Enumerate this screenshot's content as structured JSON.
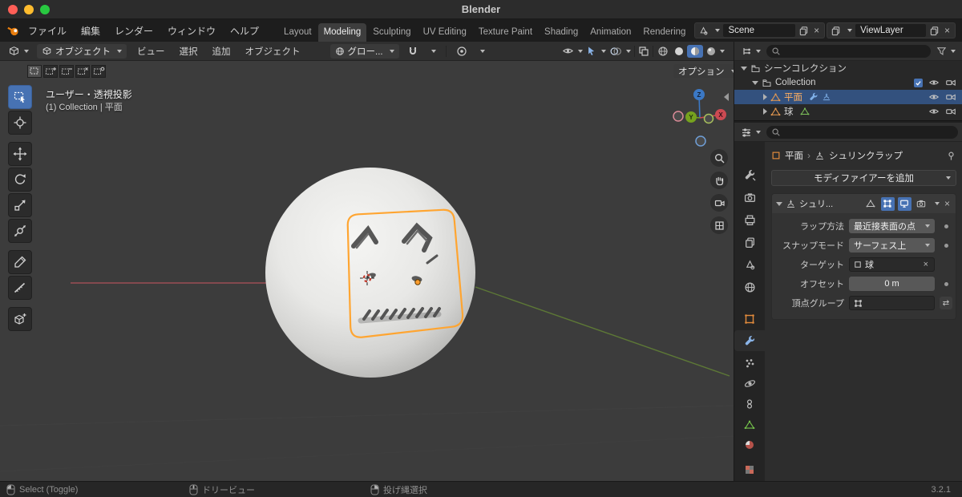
{
  "icons": {
    "close": "×",
    "swap": "⇄",
    "chevron": "›"
  },
  "titlebar": {
    "title": "Blender"
  },
  "topbar": {
    "menus": [
      "ファイル",
      "編集",
      "レンダー",
      "ウィンドウ",
      "ヘルプ"
    ],
    "workspaces": [
      "Layout",
      "Modeling",
      "Sculpting",
      "UV Editing",
      "Texture Paint",
      "Shading",
      "Animation",
      "Rendering"
    ],
    "active_workspace": "Modeling",
    "scene": "Scene",
    "view_layer": "ViewLayer"
  },
  "tool_header": {
    "mode": "オブジェクト",
    "menus": [
      "ビュー",
      "選択",
      "追加",
      "オブジェクト"
    ],
    "orientation": "グロー...",
    "options_button": "オプション"
  },
  "viewport": {
    "view_label": "ユーザー・透視投影",
    "context_label": "(1) Collection | 平面",
    "axis_x": "X",
    "axis_y": "Y",
    "axis_z": "Z"
  },
  "outliner": {
    "scene_collection": "シーンコレクション",
    "collection": "Collection",
    "object_plane": "平面",
    "object_sphere": "球"
  },
  "properties": {
    "breadcrumb_object": "平面",
    "breadcrumb_modifier": "シュリンクラップ",
    "add_modifier_button": "モディファイアーを追加",
    "modifier": {
      "name": "シュリ...",
      "wrap_method_label": "ラップ方法",
      "wrap_method_value": "最近接表面の点",
      "snap_mode_label": "スナップモード",
      "snap_mode_value": "サーフェス上",
      "target_label": "ターゲット",
      "target_value": "球",
      "offset_label": "オフセット",
      "offset_value": "0 m",
      "vertex_group_label": "頂点グループ"
    }
  },
  "statusbar": {
    "select": "Select (Toggle)",
    "dolly": "ドリービュー",
    "lasso": "投げ縄選択",
    "version": "3.2.1"
  }
}
